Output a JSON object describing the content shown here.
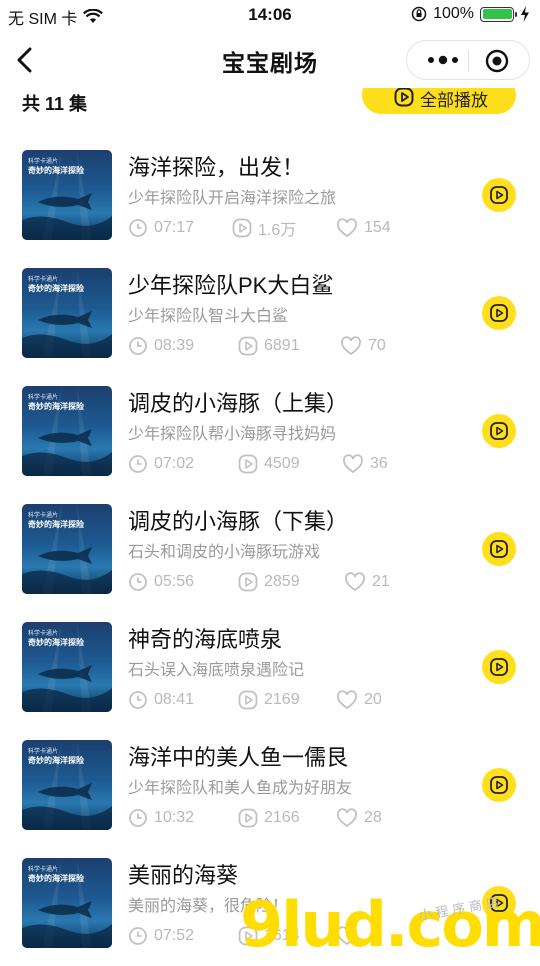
{
  "status": {
    "carrier": "无 SIM 卡",
    "time": "14:06",
    "battery": "100%"
  },
  "nav": {
    "title": "宝宝剧场"
  },
  "list_header": {
    "count_text": "共 11 集",
    "play_all": "全部播放"
  },
  "episodes": [
    {
      "title": "海洋探险，出发！",
      "desc": "少年探险队开启海洋探险之旅",
      "duration": "07:17",
      "plays": "1.6万",
      "likes": "154"
    },
    {
      "title": "少年探险队PK大白鲨",
      "desc": "少年探险队智斗大白鲨",
      "duration": "08:39",
      "plays": "6891",
      "likes": "70"
    },
    {
      "title": "调皮的小海豚（上集）",
      "desc": "少年探险队帮小海豚寻找妈妈",
      "duration": "07:02",
      "plays": "4509",
      "likes": "36"
    },
    {
      "title": "调皮的小海豚（下集）",
      "desc": "石头和调皮的小海豚玩游戏",
      "duration": "05:56",
      "plays": "2859",
      "likes": "21"
    },
    {
      "title": "神奇的海底喷泉",
      "desc": "石头误入海底喷泉遇险记",
      "duration": "08:41",
      "plays": "2169",
      "likes": "20"
    },
    {
      "title": "海洋中的美人鱼一儒艮",
      "desc": "少年探险队和美人鱼成为好朋友",
      "duration": "10:32",
      "plays": "2166",
      "likes": "28"
    },
    {
      "title": "美丽的海葵",
      "desc": "美丽的海葵，很危险！",
      "duration": "07:52",
      "plays": "1614",
      "likes": ""
    }
  ],
  "cover": {
    "small": "科学卡通片",
    "title": "奇妙的海洋探险"
  },
  "watermark": {
    "main": "9lud.com",
    "sub": "小程序商店"
  },
  "colors": {
    "accent": "#ffdf1c",
    "meta": "#b9b9b9",
    "desc": "#9a9a9a"
  }
}
